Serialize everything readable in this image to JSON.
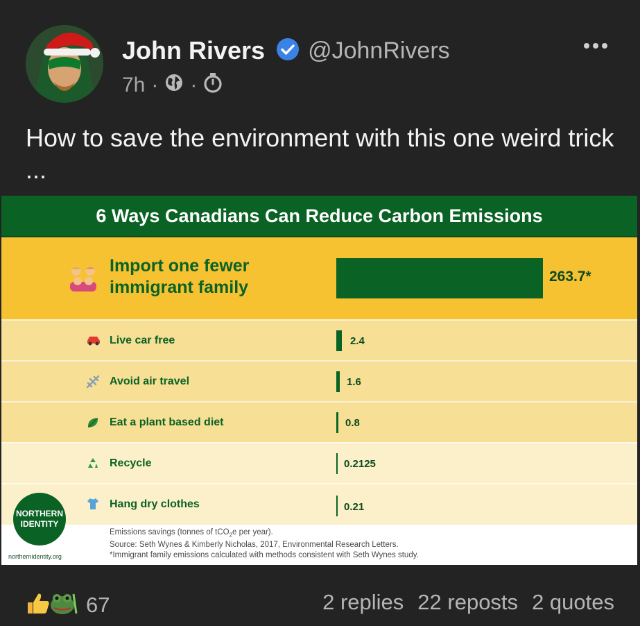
{
  "post": {
    "author_name": "John Rivers",
    "handle": "@JohnRivers",
    "time": "7h",
    "sep": "·",
    "text": "How to save the environment with this one weird trick ...",
    "icons": {
      "verified": "verified-badge-icon",
      "globe": "globe-icon",
      "timer": "timer-icon",
      "more": "more-options-icon"
    }
  },
  "infographic": {
    "title": "6 Ways Canadians Can Reduce Carbon Emissions",
    "rows": [
      {
        "icon": "family-emoji",
        "label_line1": "Import one fewer",
        "label_line2": "immigrant family",
        "value": "263.7*"
      },
      {
        "icon": "car-emoji",
        "label": "Live car free",
        "value": "2.4"
      },
      {
        "icon": "airplane-emoji",
        "label": "Avoid air travel",
        "value": "1.6"
      },
      {
        "icon": "leaf-emoji",
        "label": "Eat a plant based diet",
        "value": "0.8"
      },
      {
        "icon": "recycle-emoji",
        "label": "Recycle",
        "value": "0.2125"
      },
      {
        "icon": "shirt-emoji",
        "label": "Hang dry clothes",
        "value": "0.21"
      }
    ],
    "logo_line1": "NORTHERN",
    "logo_line2": "IDENTITY",
    "logo_url": "northernidentity.org",
    "notes": {
      "line1_prefix": "Emissions savings (tonnes of tCO",
      "line1_sub": "2",
      "line1_suffix": "e per year).",
      "line2": "Source: Seth Wynes & Kimberly Nicholas, 2017, Environmental Research Letters.",
      "line3": "*Immigrant family emissions calculated with methods consistent with Seth Wynes study."
    },
    "colors": {
      "green": "#0a6224",
      "gold": "#f6c232",
      "light1": "#f7e095",
      "light2": "#fbf0c9"
    }
  },
  "footer": {
    "reactions": [
      "thumbs-up-emoji",
      "frog-emoji"
    ],
    "reaction_count": "67",
    "replies": "2 replies",
    "reposts": "22 reposts",
    "quotes": "2 quotes"
  }
}
